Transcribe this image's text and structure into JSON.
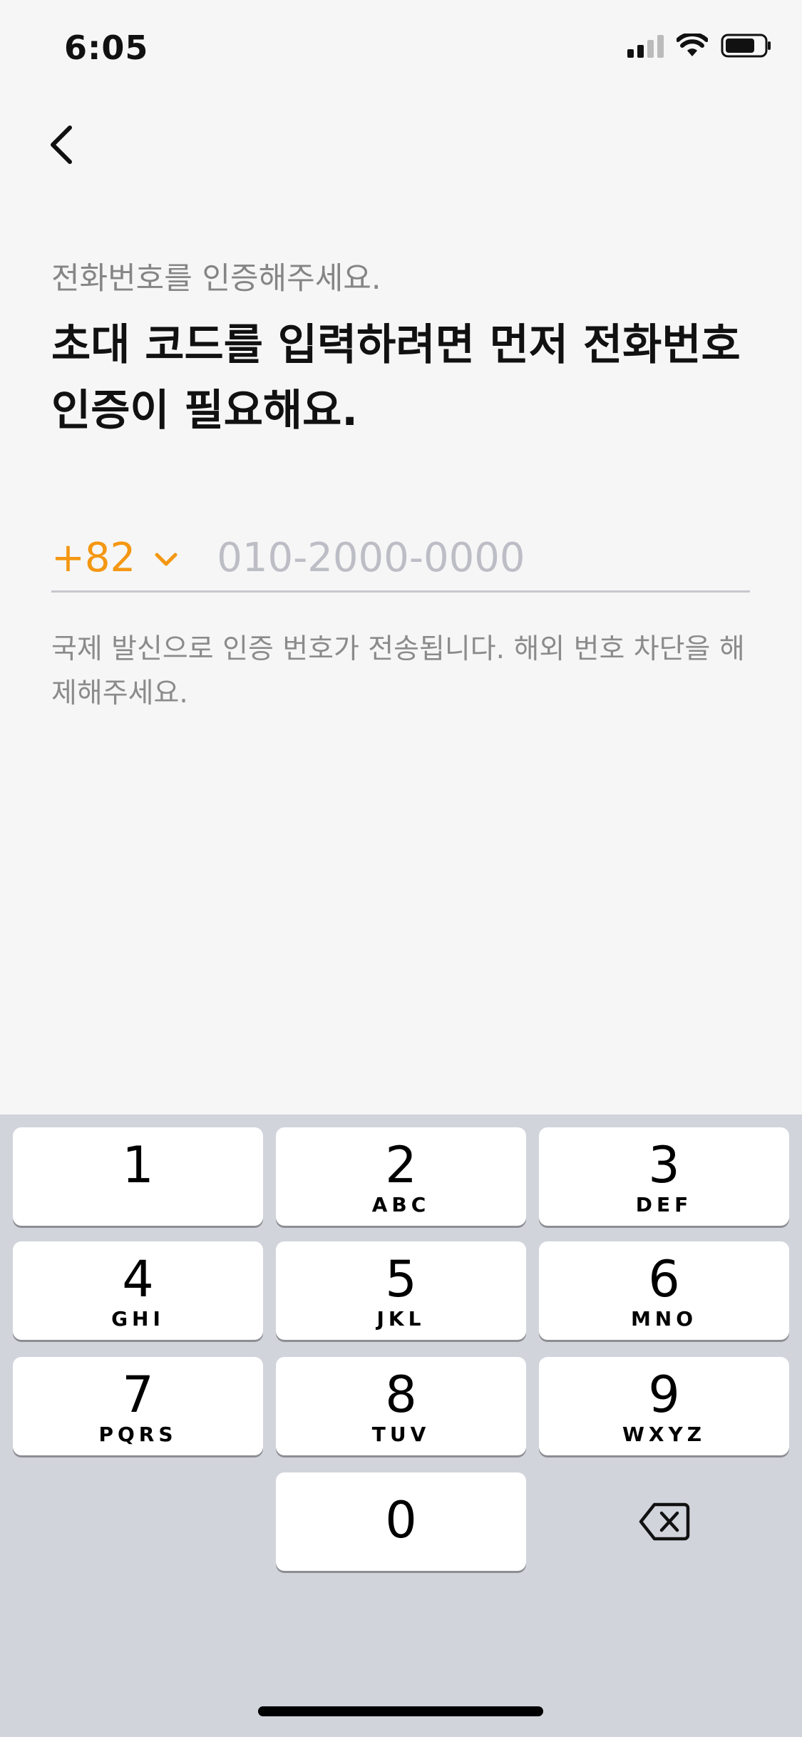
{
  "status_bar": {
    "time": "6:05"
  },
  "subtitle": "전화번호를 인증해주세요.",
  "headline": "초대 코드를 입력하려면 먼저 전화번호 인증이 필요해요.",
  "phone": {
    "country_code": "+82",
    "placeholder": "010-2000-0000",
    "value": ""
  },
  "note": "국제 발신으로 인증 번호가 전송됩니다. 해외 번호 차단을 해제해주세요.",
  "keypad": {
    "keys": [
      {
        "num": "1",
        "letters": ""
      },
      {
        "num": "2",
        "letters": "ABC"
      },
      {
        "num": "3",
        "letters": "DEF"
      },
      {
        "num": "4",
        "letters": "GHI"
      },
      {
        "num": "5",
        "letters": "JKL"
      },
      {
        "num": "6",
        "letters": "MNO"
      },
      {
        "num": "7",
        "letters": "PQRS"
      },
      {
        "num": "8",
        "letters": "TUV"
      },
      {
        "num": "9",
        "letters": "WXYZ"
      },
      {
        "num": "0",
        "letters": ""
      }
    ]
  },
  "colors": {
    "accent": "#f49712",
    "placeholder": "#bdbdc6",
    "keypad_bg": "#d1d4db"
  }
}
